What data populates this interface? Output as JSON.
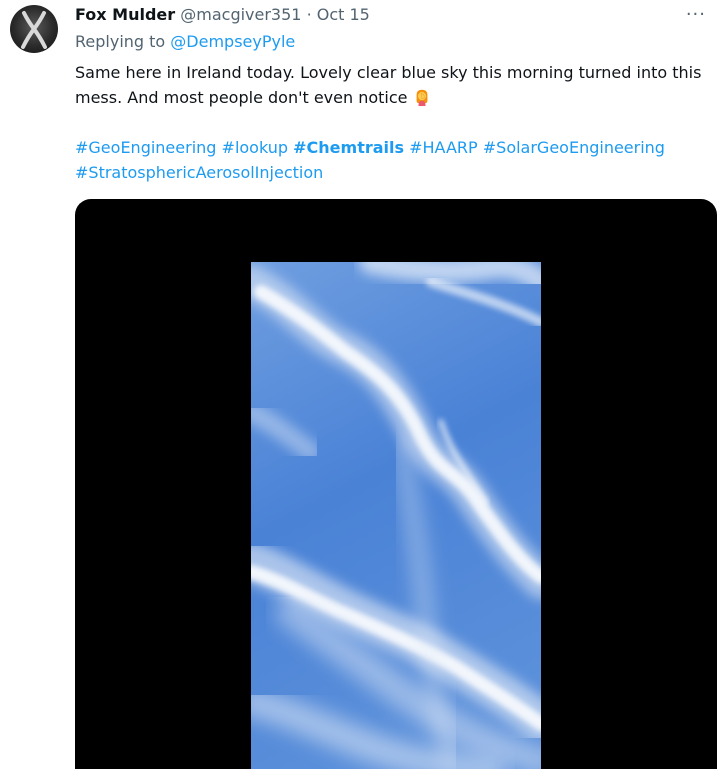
{
  "tweet": {
    "author_name": "Fox Mulder",
    "handle": "@macgiver351",
    "separator": "·",
    "date": "Oct 15",
    "more_label": "···",
    "replying_prefix": "Replying to",
    "replying_to": "@DempseyPyle",
    "text": "Same here in Ireland today. Lovely clear blue sky this morning turned into this mess. And most people don't even notice",
    "emoji_icon": "woman-facepalming-icon",
    "hashtags": [
      "#GeoEngineering",
      "#lookup",
      "#Chemtrails",
      "#HAARP",
      "#SolarGeoEngineering",
      "#StratosphericAerosolInjection"
    ],
    "hashtag_bold_index": 2
  },
  "colors": {
    "link": "#1d9bf0",
    "secondary_text": "#536471",
    "primary_text": "#0f1419",
    "media_background": "#000000",
    "sky": "#4f86d9"
  }
}
